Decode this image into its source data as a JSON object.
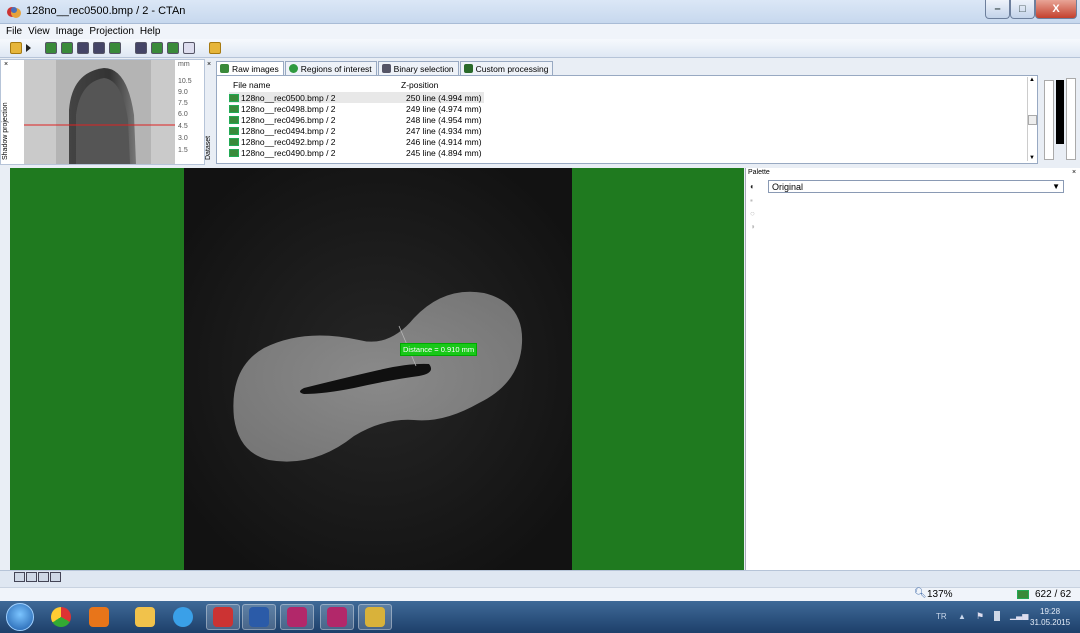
{
  "window": {
    "title": "128no__rec0500.bmp / 2 - CTAn",
    "min_glyph": "–",
    "max_glyph": "□",
    "close_glyph": "X"
  },
  "menu": [
    "File",
    "View",
    "Image",
    "Projection",
    "Help"
  ],
  "shadow_projection": {
    "label": "Shadow projection",
    "unit": "mm",
    "ticks": [
      "10.5",
      "9.0",
      "7.5",
      "6.0",
      "4.5",
      "3.0",
      "1.5"
    ]
  },
  "tabs": [
    {
      "label": "Raw images",
      "active": true,
      "icon": "image-icon"
    },
    {
      "label": "Regions of interest",
      "active": false,
      "icon": "roi-icon"
    },
    {
      "label": "Binary selection",
      "active": false,
      "icon": "binary-icon"
    },
    {
      "label": "Custom processing",
      "active": false,
      "icon": "custom-icon"
    }
  ],
  "dataset_label": "Dataset",
  "file_list": {
    "columns": [
      "File name",
      "Z-position"
    ],
    "rows": [
      {
        "name": "128no__rec0500.bmp / 2",
        "z": "250 line (4.994 mm)",
        "selected": true
      },
      {
        "name": "128no__rec0498.bmp / 2",
        "z": "249 line (4.974 mm)",
        "selected": false
      },
      {
        "name": "128no__rec0496.bmp / 2",
        "z": "248 line (4.954 mm)",
        "selected": false
      },
      {
        "name": "128no__rec0494.bmp / 2",
        "z": "247 line (4.934 mm)",
        "selected": false
      },
      {
        "name": "128no__rec0492.bmp / 2",
        "z": "246 line (4.914 mm)",
        "selected": false
      },
      {
        "name": "128no__rec0490.bmp / 2",
        "z": "245 line (4.894 mm)",
        "selected": false
      }
    ]
  },
  "viewer": {
    "distance_label": "Distance = 0.910 mm"
  },
  "palette": {
    "title": "Palette",
    "close": "×",
    "selected": "Original"
  },
  "status": {
    "zoom": "137%",
    "count": "622 / 62"
  },
  "taskbar": {
    "lang": "TR",
    "time": "19:28",
    "date": "31.05.2015"
  }
}
